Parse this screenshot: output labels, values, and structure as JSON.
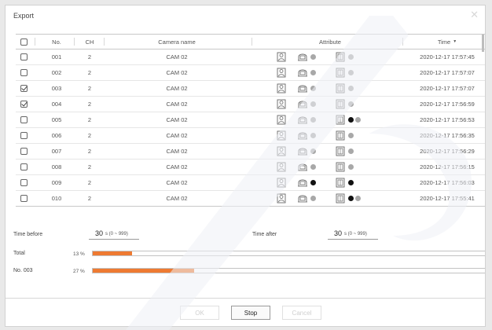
{
  "dialog": {
    "title": "Export",
    "close_glyph": "✕"
  },
  "table": {
    "headers": {
      "no": "No.",
      "ch": "CH",
      "camera": "Camera name",
      "attribute": "Attribute",
      "time": "Time",
      "sort_glyph": "▼"
    },
    "rows": [
      {
        "checked": false,
        "no": "001",
        "ch": "2",
        "camera": "CAM 02",
        "time": "2020-12-17 17:57:45",
        "dots": [
          "#a8a8a8"
        ],
        "dots2": [
          "#a8a8a8"
        ]
      },
      {
        "checked": false,
        "no": "002",
        "ch": "2",
        "camera": "CAM 02",
        "time": "2020-12-17 17:57:07",
        "dots": [
          "#a8a8a8"
        ],
        "dots2": [
          "#a8a8a8"
        ]
      },
      {
        "checked": true,
        "no": "003",
        "ch": "2",
        "camera": "CAM 02",
        "time": "2020-12-17 17:57:07",
        "dots": [
          "#a8a8a8"
        ],
        "dots2": [
          "#a8a8a8"
        ]
      },
      {
        "checked": true,
        "no": "004",
        "ch": "2",
        "camera": "CAM 02",
        "time": "2020-12-17 17:56:59",
        "dots": [
          "#a8a8a8"
        ],
        "dots2": [
          "#a8a8a8"
        ]
      },
      {
        "checked": false,
        "no": "005",
        "ch": "2",
        "camera": "CAM 02",
        "time": "2020-12-17 17:56:53",
        "dots": [
          "#a8a8a8"
        ],
        "dots2": [
          "#111111",
          "#a8a8a8"
        ]
      },
      {
        "checked": false,
        "no": "006",
        "ch": "2",
        "camera": "CAM 02",
        "time": "2020-12-17 17:56:35",
        "dots": [
          "#a8a8a8"
        ],
        "dots2": [
          "#a8a8a8"
        ]
      },
      {
        "checked": false,
        "no": "007",
        "ch": "2",
        "camera": "CAM 02",
        "time": "2020-12-17 17:56:29",
        "dots": [
          "#a8a8a8"
        ],
        "dots2": [
          "#a8a8a8"
        ]
      },
      {
        "checked": false,
        "no": "008",
        "ch": "2",
        "camera": "CAM 02",
        "time": "2020-12-17 17:56:15",
        "dots": [
          "#a8a8a8"
        ],
        "dots2": [
          "#a8a8a8"
        ]
      },
      {
        "checked": false,
        "no": "009",
        "ch": "2",
        "camera": "CAM 02",
        "time": "2020-12-17 17:56:03",
        "dots": [
          "#111111"
        ],
        "dots2": [
          "#111111"
        ]
      },
      {
        "checked": false,
        "no": "010",
        "ch": "2",
        "camera": "CAM 02",
        "time": "2020-12-17 17:55:41",
        "dots": [
          "#a8a8a8"
        ],
        "dots2": [
          "#111111",
          "#a8a8a8"
        ]
      }
    ]
  },
  "time_before": {
    "label": "Time before",
    "value": "30",
    "unit": "s (0 ~ 999)"
  },
  "time_after": {
    "label": "Time after",
    "value": "30",
    "unit": "s (0 ~ 999)"
  },
  "progress": [
    {
      "label": "Total",
      "percent_text": "13 %",
      "fraction": 0.1
    },
    {
      "label": "No. 003",
      "percent_text": "27 %",
      "fraction": 0.255
    }
  ],
  "buttons": {
    "ok": "OK",
    "stop": "Stop",
    "cancel": "Cancel"
  },
  "colors": {
    "accent": "#ee7a32",
    "dot_gray": "#a8a8a8",
    "dot_black": "#111111"
  },
  "icons": {
    "attr1": "person-icon",
    "attr2": "vehicle-face-icon",
    "attr3": "door-sensor-icon"
  }
}
